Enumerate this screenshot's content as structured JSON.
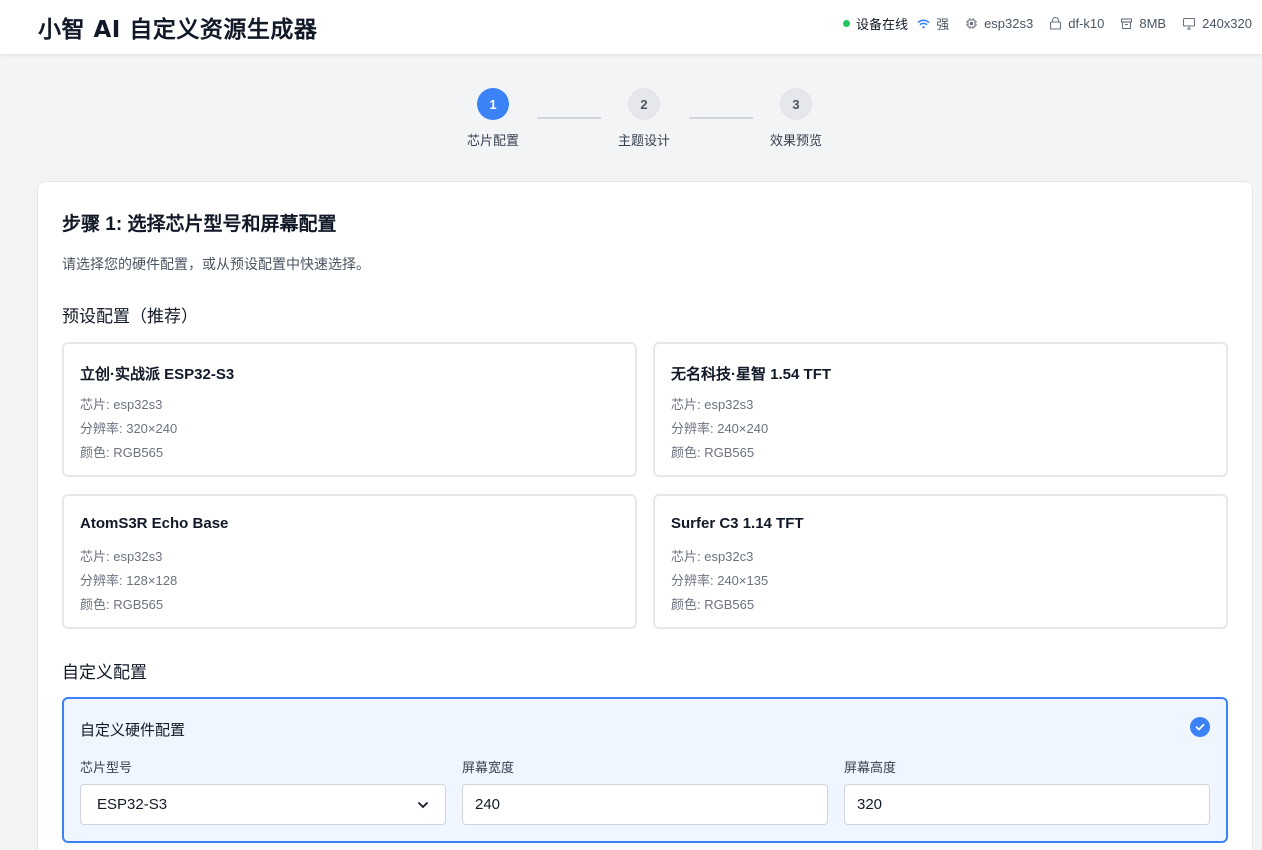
{
  "header": {
    "title": "小智 AI 自定义资源生成器",
    "status": {
      "online": "设备在线",
      "signal": "强",
      "chip": "esp32s3",
      "board": "df-k10",
      "flash": "8MB",
      "resolution": "240x320"
    },
    "colors": {
      "online_dot": "#22c55e",
      "accent": "#3b82f6"
    }
  },
  "stepper": {
    "steps": [
      {
        "num": "1",
        "label": "芯片配置",
        "state": "active"
      },
      {
        "num": "2",
        "label": "主题设计",
        "state": "inactive"
      },
      {
        "num": "3",
        "label": "效果预览",
        "state": "inactive"
      }
    ]
  },
  "main": {
    "title": "步骤 1: 选择芯片型号和屏幕配置",
    "description": "请选择您的硬件配置，或从预设配置中快速选择。",
    "presets_title": "预设配置（推荐）",
    "presets": [
      {
        "name": "立创·实战派 ESP32-S3",
        "chip": "芯片: esp32s3",
        "resolution": "分辨率: 320×240",
        "color": "颜色: RGB565"
      },
      {
        "name": "无名科技·星智 1.54 TFT",
        "chip": "芯片: esp32s3",
        "resolution": "分辨率: 240×240",
        "color": "颜色: RGB565"
      },
      {
        "name": "AtomS3R Echo Base",
        "chip": "芯片: esp32s3",
        "resolution": "分辨率: 128×128",
        "color": "颜色: RGB565"
      },
      {
        "name": "Surfer C3 1.14 TFT",
        "chip": "芯片: esp32c3",
        "resolution": "分辨率: 240×135",
        "color": "颜色: RGB565"
      }
    ],
    "custom_title": "自定义配置",
    "custom": {
      "heading": "自定义硬件配置",
      "chip_label": "芯片型号",
      "chip_value": "ESP32-S3",
      "width_label": "屏幕宽度",
      "width_value": "240",
      "height_label": "屏幕高度",
      "height_value": "320"
    }
  }
}
